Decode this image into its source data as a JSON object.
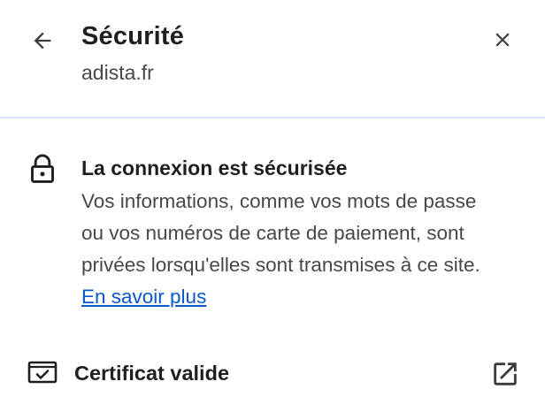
{
  "header": {
    "title": "Sécurité",
    "site": "adista.fr",
    "back_icon": "arrow-back-icon",
    "close_icon": "close-icon"
  },
  "connection": {
    "icon": "lock-icon",
    "title": "La connexion est sécurisée",
    "description": "Vos informations, comme vos mots de passe ou vos numéros de carte de paiement, sont privées lorsqu'elles sont transmises à ce site.",
    "learn_more": "En savoir plus"
  },
  "certificate": {
    "icon": "certificate-icon",
    "label": "Certificat valide",
    "external_icon": "open-in-new-icon"
  },
  "colors": {
    "text_primary": "#1f1f1f",
    "text_secondary": "#474747",
    "link": "#0b57d0",
    "divider": "#d3e3fd"
  }
}
